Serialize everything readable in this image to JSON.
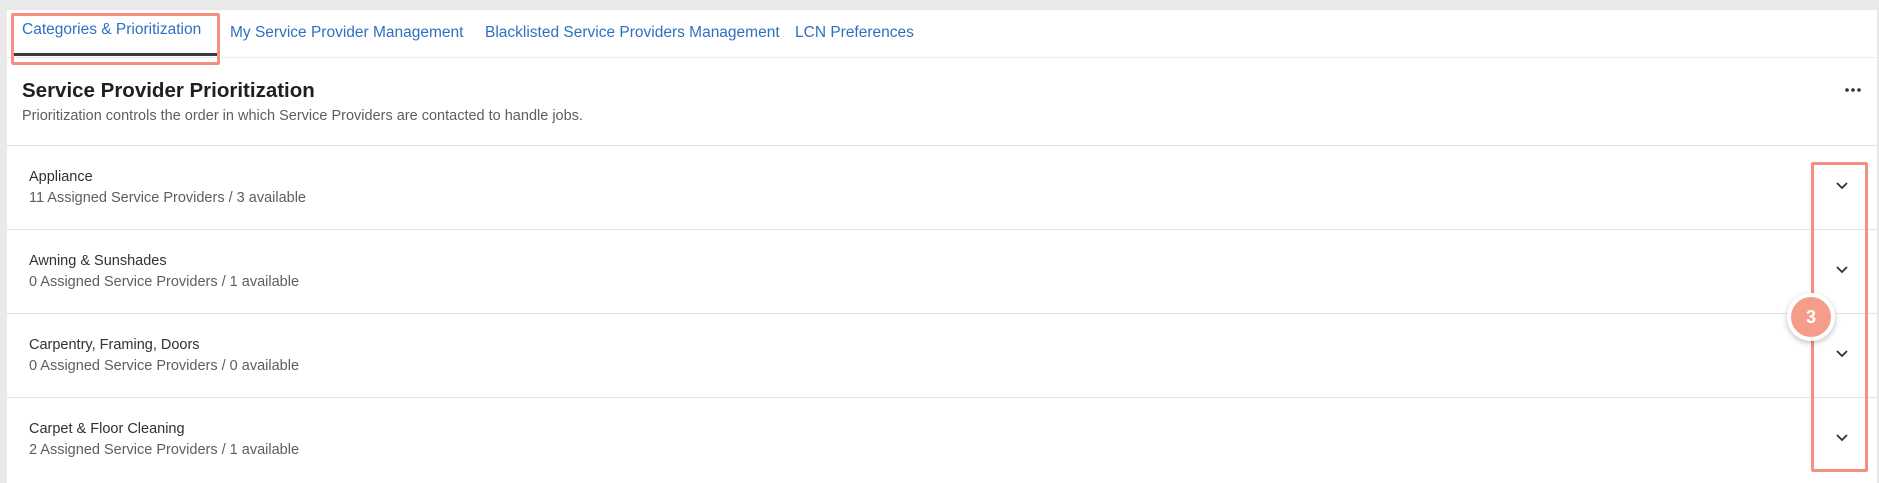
{
  "tabs": [
    {
      "label": "Categories & Prioritization"
    },
    {
      "label": "My Service Provider Management"
    },
    {
      "label": "Blacklisted Service Providers Management"
    },
    {
      "label": "LCN Preferences"
    }
  ],
  "header": {
    "title": "Service Provider Prioritization",
    "subtitle": "Prioritization controls the order in which Service Providers are contacted to handle jobs."
  },
  "categories": [
    {
      "name": "Appliance",
      "info": "11 Assigned Service Providers / 3 available"
    },
    {
      "name": "Awning & Sunshades",
      "info": "0 Assigned Service Providers / 1 available"
    },
    {
      "name": "Carpentry, Framing, Doors",
      "info": "0 Assigned Service Providers / 0 available"
    },
    {
      "name": "Carpet & Floor Cleaning",
      "info": "2 Assigned Service Providers / 1 available"
    }
  ],
  "annotation": {
    "step_number": "3",
    "color": "#f4907f"
  },
  "colors": {
    "link": "#2f6fc2",
    "accent_underline": "#3b3b3b"
  },
  "icons": {
    "more": "more-options-icon",
    "expand": "chevron-down-icon"
  }
}
